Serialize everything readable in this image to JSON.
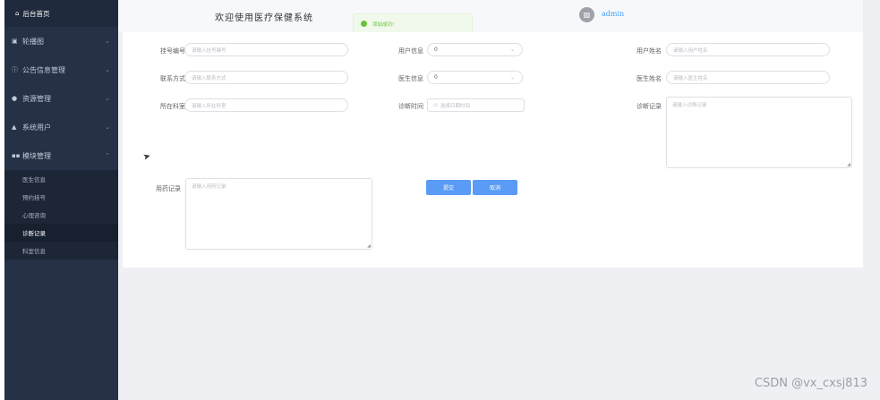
{
  "sidebar": {
    "home": {
      "icon": "home-icon",
      "label": "后台首页"
    },
    "menus": [
      {
        "icon": "image-icon",
        "label": "轮播图"
      },
      {
        "icon": "info-icon",
        "label": "公告信息管理"
      },
      {
        "icon": "location-icon",
        "label": "资源管理"
      },
      {
        "icon": "user-icon",
        "label": "系统用户"
      },
      {
        "icon": "grid-icon",
        "label": "模块管理"
      }
    ],
    "submenu": [
      {
        "label": "医生信息",
        "active": false
      },
      {
        "label": "预约挂号",
        "active": false
      },
      {
        "label": "心理咨询",
        "active": false
      },
      {
        "label": "诊断记录",
        "active": true
      },
      {
        "label": "科室信息",
        "active": false
      }
    ]
  },
  "header": {
    "welcome": "欢迎使用医疗保健系统",
    "toast": "添加成功!",
    "username": "admin"
  },
  "form": {
    "reg_no": {
      "label": "挂号编号",
      "placeholder": "请输入挂号编号"
    },
    "user_info": {
      "label": "用户信息",
      "value": "0"
    },
    "user_name": {
      "label": "用户姓名",
      "placeholder": "请输入用户姓名"
    },
    "contact": {
      "label": "联系方式",
      "placeholder": "请输入联系方式"
    },
    "doctor_info": {
      "label": "医生信息",
      "value": "0"
    },
    "doctor_name": {
      "label": "医生姓名",
      "placeholder": "请输入医生姓名"
    },
    "department": {
      "label": "所在科室",
      "placeholder": "请输入所在科室"
    },
    "diag_time": {
      "label": "诊断时间",
      "placeholder": "选择日期时间"
    },
    "diag_record": {
      "label": "诊断记录",
      "placeholder": "请输入诊断记录"
    },
    "med_record": {
      "label": "用药记录",
      "placeholder": "请输入用药记录"
    },
    "submit": "提交",
    "cancel": "取消"
  },
  "watermark": "CSDN @vx_cxsj813",
  "colors": {
    "sidebar_bg": "#263046",
    "primary": "#409eff",
    "button": "#5a9cf5",
    "success": "#67c23a"
  }
}
